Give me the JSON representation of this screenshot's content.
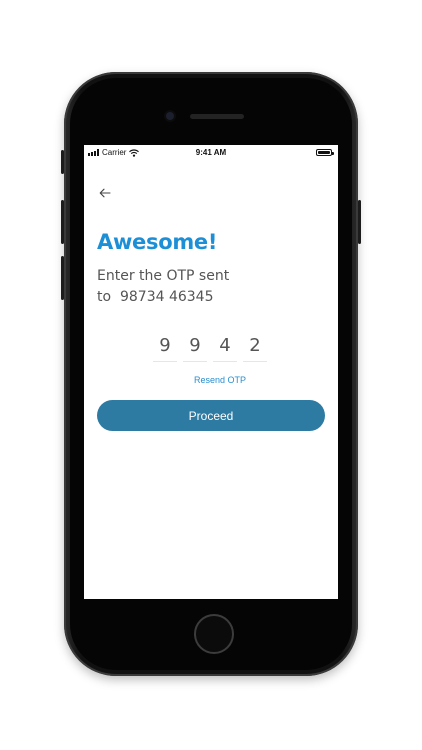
{
  "status_bar": {
    "carrier": "Carrier",
    "time": "9:41 AM"
  },
  "screen": {
    "heading": "Awesome!",
    "subtitle_line1": "Enter the OTP sent",
    "subtitle_prefix": "to",
    "phone_number": "98734 46345",
    "otp_digits": [
      "9",
      "9",
      "4",
      "2"
    ],
    "resend_label": "Resend OTP",
    "proceed_label": "Proceed"
  },
  "colors": {
    "heading": "#1d8fd6",
    "link": "#2a8fd0",
    "button": "#2d7aa3"
  },
  "icons": {
    "back": "arrow-left-icon",
    "wifi": "wifi-icon",
    "battery": "battery-icon",
    "signal": "signal-bars-icon"
  }
}
